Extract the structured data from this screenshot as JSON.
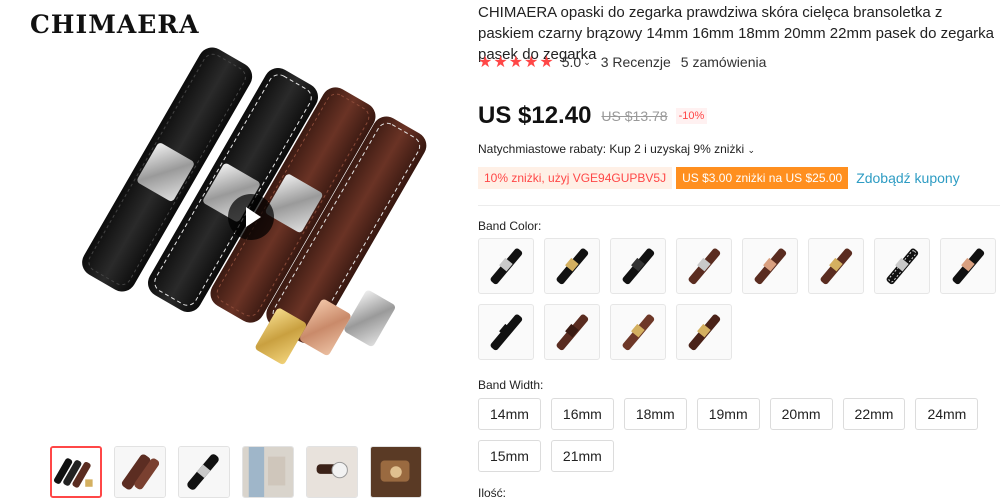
{
  "gallery": {
    "brand_logo": "CHIMAERA",
    "thumbnails": [
      {
        "name": "thumb-1",
        "active": true
      },
      {
        "name": "thumb-2",
        "active": false
      },
      {
        "name": "thumb-3",
        "active": false
      },
      {
        "name": "thumb-4",
        "active": false
      },
      {
        "name": "thumb-5",
        "active": false
      },
      {
        "name": "thumb-6",
        "active": false
      }
    ]
  },
  "product": {
    "title": "CHIMAERA opaski do zegarka prawdziwa skóra cielęca bransoletka z paskiem czarny brązowy 14mm 16mm 18mm 20mm 22mm pasek do zegarka pasek do zegarka",
    "stars": "★★★★★",
    "rating": "5.0",
    "rating_chevron": "⌄",
    "reviews": "3 Recenzje",
    "orders": "5 zamówienia"
  },
  "price": {
    "current": "US $12.40",
    "original": "US $13.78",
    "discount": "-10%"
  },
  "promo": {
    "instant_discount": "Natychmiastowe rabaty: Kup 2 i uzyskaj 9% zniżki",
    "instant_chevron": "⌄",
    "coupon_code": "10% zniżki, użyj VGE94GUPBV5J",
    "coupon_store": "US $3.00 zniżki na US $25.00",
    "coupon_link": "Zdobądź kupony"
  },
  "band_color": {
    "label": "Band Color:",
    "swatches": [
      "black-silver",
      "black-gold",
      "black-black",
      "brown-silver",
      "brown-rosegold",
      "brown-gold",
      "black-silver-stitch",
      "black-rosegold",
      "black-dark",
      "brown-dark",
      "brown-light",
      "brown-tan"
    ]
  },
  "band_width": {
    "label": "Band Width:",
    "options": [
      "14mm",
      "16mm",
      "18mm",
      "19mm",
      "20mm",
      "22mm",
      "24mm",
      "15mm",
      "21mm"
    ]
  },
  "quantity": {
    "label": "Ilość:"
  },
  "colors": {
    "accent": "#ff4747",
    "coupon_orange": "#ff8f1f",
    "link_blue": "#2e9cc3"
  }
}
